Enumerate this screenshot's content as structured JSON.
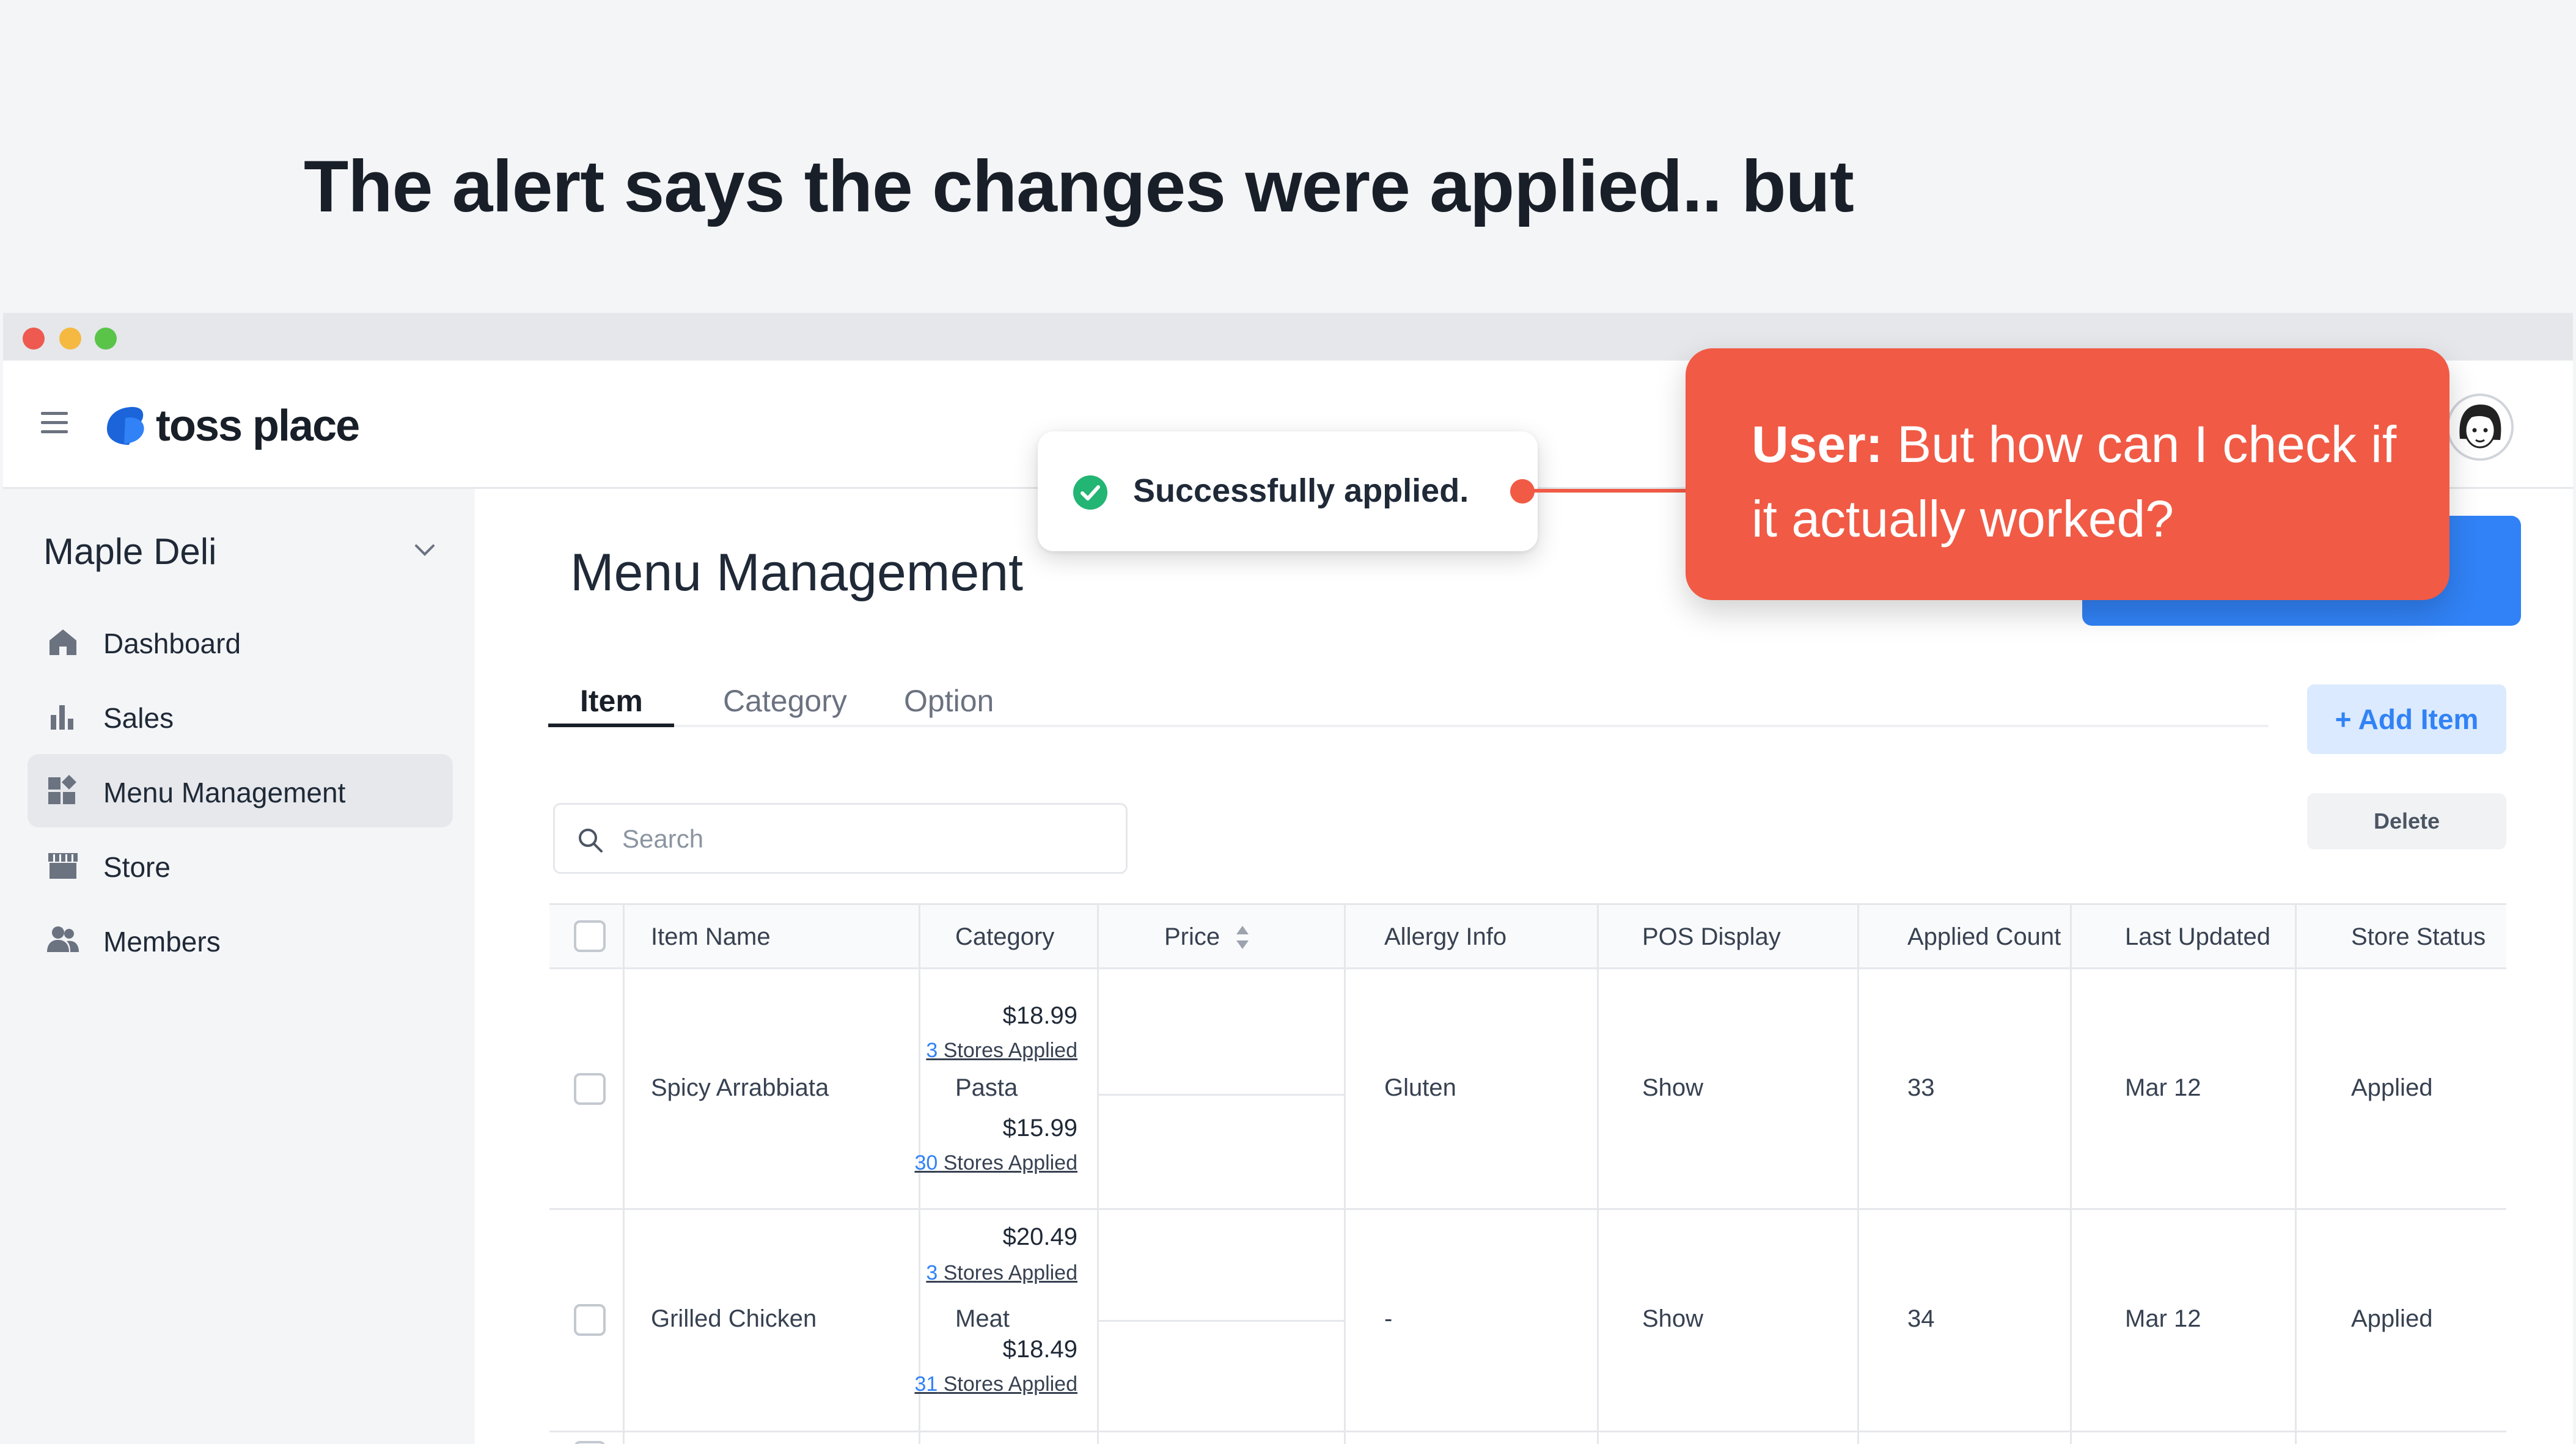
{
  "headline": "The alert says the changes were applied.. but",
  "app": {
    "logo_text": "toss place"
  },
  "sidebar": {
    "store_name": "Maple Deli",
    "items": [
      {
        "label": "Dashboard",
        "icon": "home-icon",
        "active": false
      },
      {
        "label": "Sales",
        "icon": "bar-chart-icon",
        "active": false
      },
      {
        "label": "Menu Management",
        "icon": "grid-icon",
        "active": true
      },
      {
        "label": "Store",
        "icon": "store-icon",
        "active": false
      },
      {
        "label": "Members",
        "icon": "members-icon",
        "active": false
      }
    ]
  },
  "main": {
    "title": "Menu Management",
    "tabs": [
      {
        "label": "Item",
        "active": true
      },
      {
        "label": "Category",
        "active": false
      },
      {
        "label": "Option",
        "active": false
      }
    ],
    "add_item_label": "+ Add Item",
    "search_placeholder": "Search",
    "delete_label": "Delete"
  },
  "table": {
    "columns": [
      "Item Name",
      "Category",
      "Price",
      "Allergy Info",
      "POS Display",
      "Applied Count",
      "Last Updated",
      "Store Status"
    ],
    "rows": [
      {
        "name": "Spicy Arrabbiata",
        "category": "Pasta",
        "prices": [
          {
            "value": "$18.99",
            "count": "3",
            "suffix": " Stores Applied"
          },
          {
            "value": "$15.99",
            "count": "30",
            "suffix": " Stores Applied"
          }
        ],
        "allergy": "Gluten",
        "pos_display": "Show",
        "applied_count": "33",
        "last_updated": "Mar 12",
        "status": "Applied"
      },
      {
        "name": "Grilled Chicken",
        "category": "Meat",
        "prices": [
          {
            "value": "$20.49",
            "count": "3",
            "suffix": " Stores Applied"
          },
          {
            "value": "$18.49",
            "count": "31",
            "suffix": " Stores Applied"
          }
        ],
        "allergy": "-",
        "pos_display": "Show",
        "applied_count": "34",
        "last_updated": "Mar 12",
        "status": "Applied"
      }
    ]
  },
  "toast": {
    "message": "Successfully applied."
  },
  "callout": {
    "speaker": "User:",
    "text": " But how can I check if it actually worked?"
  },
  "colors": {
    "accent": "#3182f6",
    "callout": "#f15a45",
    "success": "#22b573"
  }
}
